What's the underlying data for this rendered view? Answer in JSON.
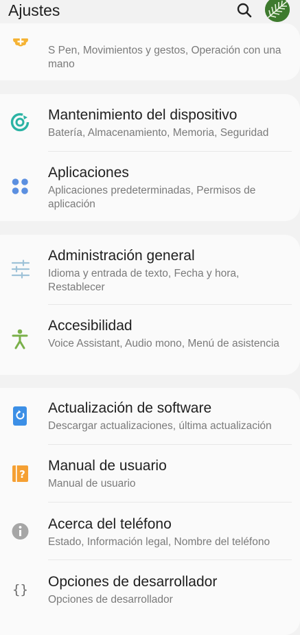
{
  "header": {
    "title": "Ajustes",
    "search_icon": "search-icon",
    "avatar": "profile-avatar"
  },
  "groups": [
    {
      "items": [
        {
          "icon": "puzzle-plus-icon",
          "title": "",
          "subtitle": "S Pen, Movimientos y gestos, Operación con una mano"
        }
      ]
    },
    {
      "items": [
        {
          "icon": "device-care-icon",
          "title": "Mantenimiento del dispositivo",
          "subtitle": "Batería, Almacenamiento, Memoria, Seguridad"
        },
        {
          "icon": "apps-icon",
          "title": "Aplicaciones",
          "subtitle": "Aplicaciones predeterminadas, Permisos de aplicación"
        }
      ]
    },
    {
      "items": [
        {
          "icon": "sliders-icon",
          "title": "Administración general",
          "subtitle": "Idioma y entrada de texto, Fecha y hora, Restablecer"
        },
        {
          "icon": "accessibility-icon",
          "title": "Accesibilidad",
          "subtitle": "Voice Assistant, Audio mono, Menú de asistencia"
        }
      ]
    },
    {
      "items": [
        {
          "icon": "software-update-icon",
          "title": "Actualización de software",
          "subtitle": "Descargar actualizaciones, última actualización"
        },
        {
          "icon": "user-manual-icon",
          "title": "Manual de usuario",
          "subtitle": "Manual de usuario"
        },
        {
          "icon": "info-icon",
          "title": "Acerca del teléfono",
          "subtitle": "Estado, Información legal, Nombre del teléfono"
        },
        {
          "icon": "developer-options-icon",
          "title": "Opciones de desarrollador",
          "subtitle": "Opciones de desarrollador"
        }
      ]
    }
  ],
  "colors": {
    "background": "#f2f2f2",
    "card": "#fafafa",
    "advanced_icon": "#f5b335",
    "device_care_icon": "#2bb3a4",
    "apps_icon": "#5b8fe0",
    "general_icon": "#9ec2d8",
    "accessibility_icon": "#7ab04a",
    "update_icon": "#3c8fe6",
    "manual_icon": "#f5a033",
    "info_icon": "#a6a6a6",
    "developer_icon": "#6b6b6b"
  }
}
